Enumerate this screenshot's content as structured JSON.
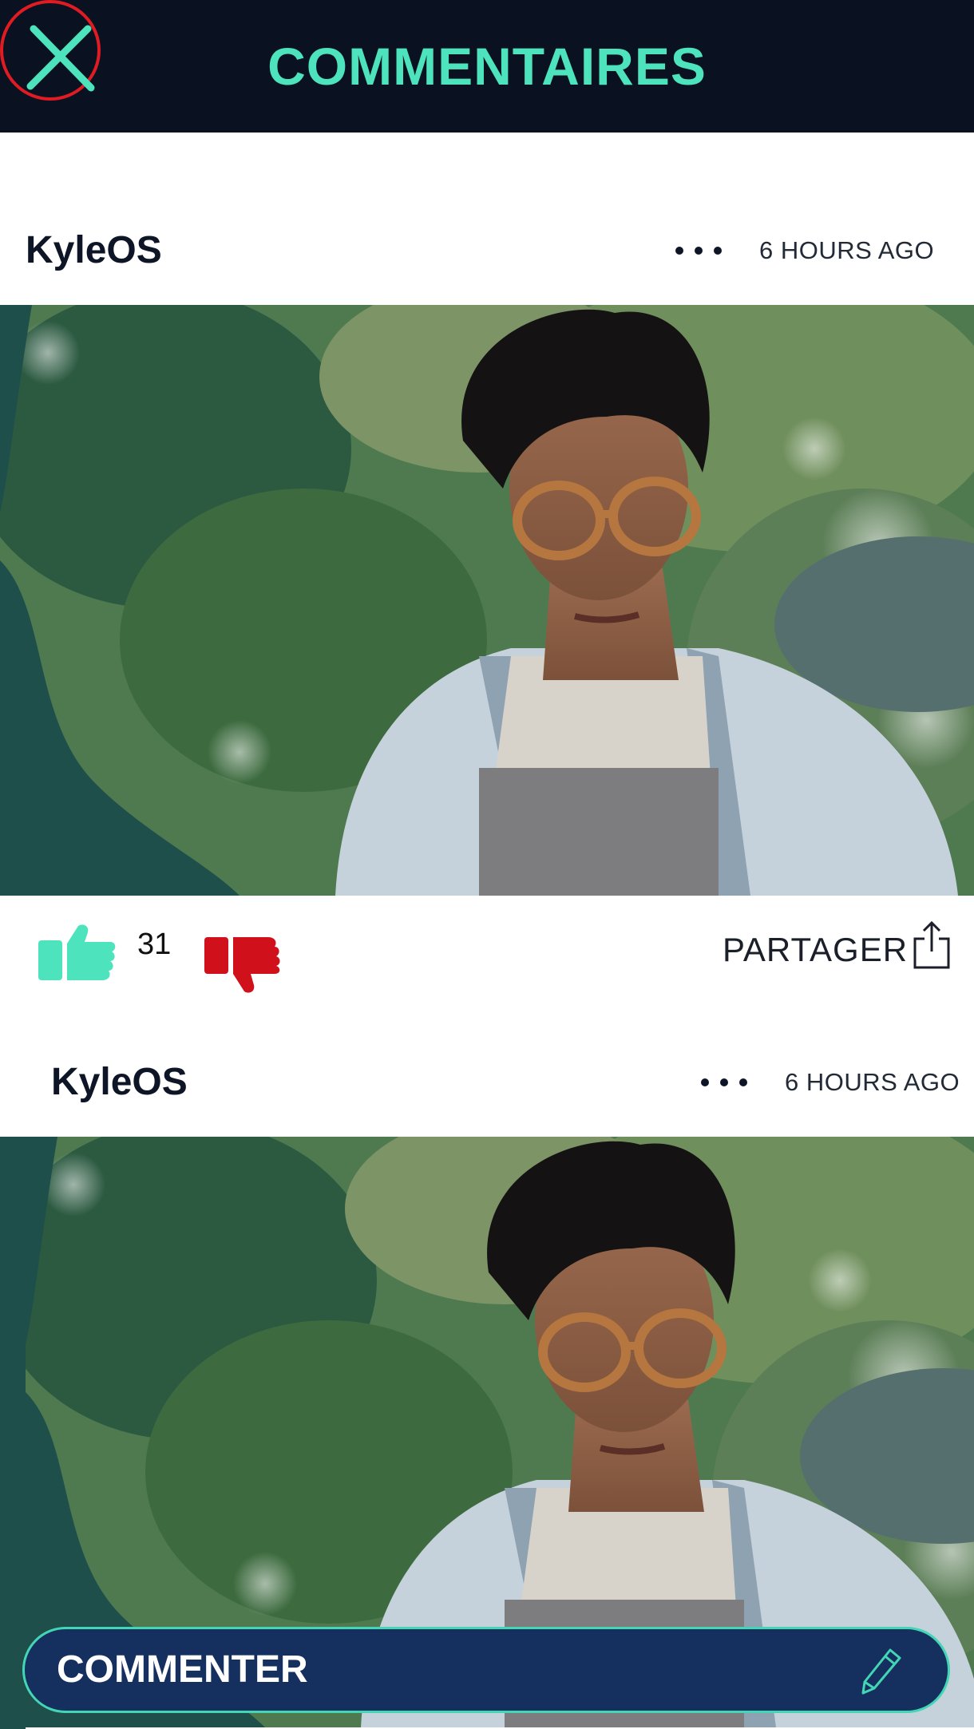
{
  "header": {
    "title": "COMMENTAIRES",
    "close_icon": "close-icon"
  },
  "posts": [
    {
      "username": "KyleOS",
      "timestamp": "6 HOURS AGO",
      "more_icon": "more-dots-icon",
      "photo": "portrait-photo"
    },
    {
      "username": "KyleOS",
      "timestamp": "6 HOURS AGO",
      "more_icon": "more-dots-icon",
      "photo": "portrait-photo"
    }
  ],
  "actions": {
    "like_count": "31",
    "like_icon": "thumbs-up-icon",
    "dislike_icon": "thumbs-down-icon",
    "share_label": "PARTAGER",
    "share_icon": "share-icon"
  },
  "composer": {
    "label": "COMMENTER",
    "icon": "pencil-icon"
  },
  "colors": {
    "header_bg": "#0a1222",
    "accent": "#4de3bd",
    "dislike": "#d0111b",
    "close_ring": "#e01b22",
    "composer_bg": "#15305e"
  }
}
